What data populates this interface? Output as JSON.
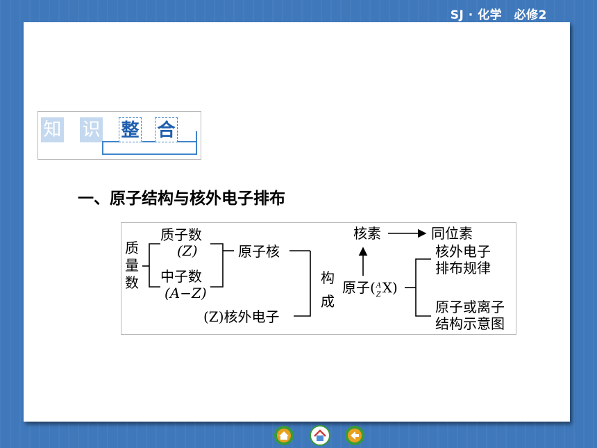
{
  "header": {
    "course_label": "SJ · 化学　必修2"
  },
  "banner": {
    "chars": [
      "知",
      "识",
      "整",
      "合"
    ]
  },
  "section": {
    "heading": "一、原子结构与核外电子排布"
  },
  "diagram": {
    "mass_number": "质量数",
    "proton_number": "质子数",
    "proton_symbol": "(Z)",
    "neutron_number": "中子数",
    "neutron_symbol": "(A−Z)",
    "nucleus": "原子核",
    "electrons": "(Z)核外电子",
    "compose": "构成",
    "atom": "原子(",
    "atom_A": "A",
    "atom_Z": "Z",
    "atom_X": "X)",
    "nuclide": "核素",
    "isotope": "同位素",
    "rule_line1": "核外电子",
    "rule_line2": "排布规律",
    "diagram_line1": "原子或离子",
    "diagram_line2": "结构示意图"
  },
  "nav": {
    "buttons": [
      {
        "icon": "home-icon",
        "color": "#e8a020"
      },
      {
        "icon": "house-icon",
        "color": "#4a8fd8"
      },
      {
        "icon": "back-icon",
        "color": "#e8a020"
      }
    ]
  }
}
